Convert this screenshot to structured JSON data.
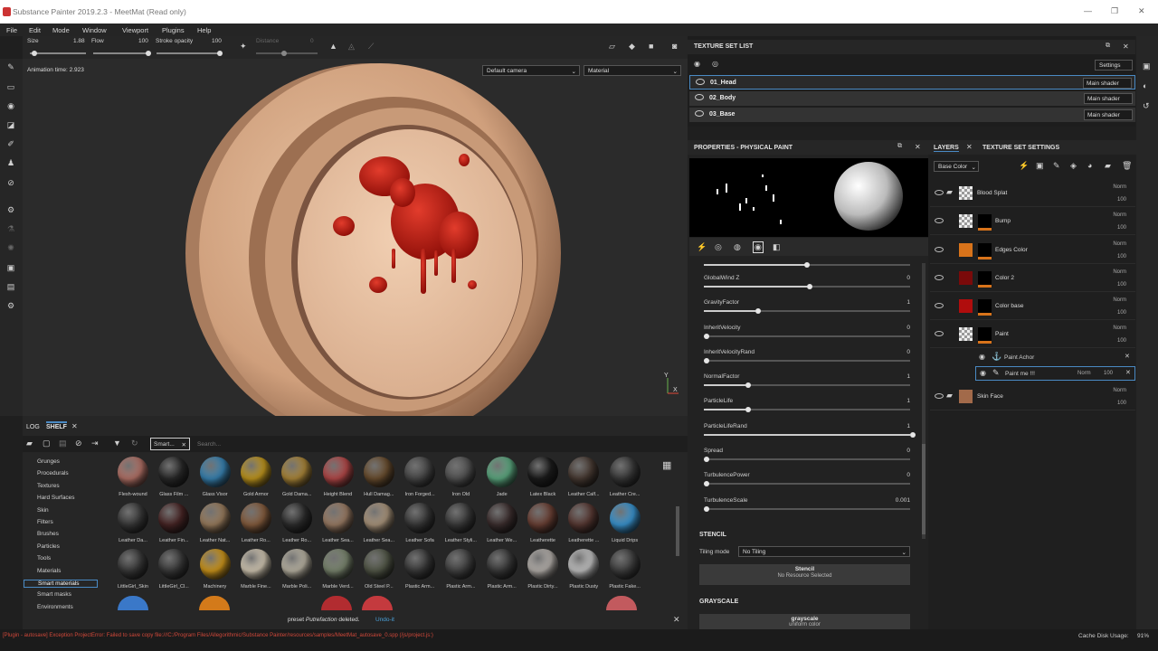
{
  "window": {
    "title": "Substance Painter 2019.2.3 - MeetMat (Read only)",
    "min": "—",
    "max": "❐",
    "close": "✕"
  },
  "menu": [
    "File",
    "Edit",
    "Mode",
    "Window",
    "Viewport",
    "Plugins",
    "Help"
  ],
  "toolbar": {
    "size_label": "Size",
    "size_value": "1.88",
    "flow_label": "Flow",
    "flow_value": "100",
    "stroke_label": "Stroke opacity",
    "stroke_value": "100",
    "distance_label": "Distance",
    "distance_value": "0"
  },
  "viewport": {
    "animation_time": "Animation time: 2.923",
    "camera": "Default camera",
    "mode": "Material",
    "axis_y": "Y",
    "axis_x": "X"
  },
  "texture_set_list": {
    "title": "TEXTURE SET LIST",
    "settings": "Settings",
    "sets": [
      {
        "name": "01_Head",
        "shader": "Main shader"
      },
      {
        "name": "02_Body",
        "shader": "Main shader"
      },
      {
        "name": "03_Base",
        "shader": "Main shader"
      }
    ]
  },
  "properties": {
    "title": "PROPERTIES - PHYSICAL PAINT",
    "rows": [
      {
        "label": "GlobalWind Z",
        "value": "0",
        "fill": 0.5
      },
      {
        "label": "GravityFactor",
        "value": "1",
        "fill": 0.25
      },
      {
        "label": "InheritVelocity",
        "value": "0",
        "fill": 0.0
      },
      {
        "label": "InheritVelocityRand",
        "value": "0",
        "fill": 0.0
      },
      {
        "label": "NormalFactor",
        "value": "1",
        "fill": 0.2
      },
      {
        "label": "ParticleLife",
        "value": "1",
        "fill": 0.2
      },
      {
        "label": "ParticleLifeRand",
        "value": "1",
        "fill": 1.0
      },
      {
        "label": "Spread",
        "value": "0",
        "fill": 0.0
      },
      {
        "label": "TurbulencePower",
        "value": "0",
        "fill": 0.0
      },
      {
        "label": "TurbulenceScale",
        "value": "0.001",
        "fill": 0.0
      }
    ],
    "stencil": "STENCIL",
    "tiling_label": "Tiling mode",
    "tiling_value": "No Tiling",
    "stencil_btn": "Stencil",
    "stencil_sub": "No Resource Selected",
    "grayscale": "GRAYSCALE",
    "grayscale_btn": "grayscale",
    "grayscale_sub": "uniform color"
  },
  "layers": {
    "tab_layers": "LAYERS",
    "tab_tss": "TEXTURE SET SETTINGS",
    "channel": "Base Color",
    "items": [
      {
        "name": "Blood Splat",
        "blend": "Norm",
        "opacity": "100",
        "thumb": "#cccccc"
      },
      {
        "name": "Bump",
        "blend": "Norm",
        "opacity": "100",
        "thumb": "#cccccc"
      },
      {
        "name": "Edges Color",
        "blend": "Norm",
        "opacity": "100",
        "thumb": "#d8731a"
      },
      {
        "name": "Color 2",
        "blend": "Norm",
        "opacity": "100",
        "thumb": "#7a0a0a"
      },
      {
        "name": "Color base",
        "blend": "Norm",
        "opacity": "100",
        "thumb": "#b00d0d"
      },
      {
        "name": "Paint",
        "blend": "Norm",
        "opacity": "100",
        "thumb": "#cccccc"
      }
    ],
    "sub_anchor": "Paint Achor",
    "sub_paint": "Paint me !!!",
    "sub_blend": "Norm",
    "sub_opacity": "100",
    "skin": {
      "name": "Skin Face",
      "blend": "Norm",
      "opacity": "100"
    }
  },
  "shelf": {
    "tab_log": "LOG",
    "tab_shelf": "SHELF",
    "filter": "Smart...",
    "search_placeholder": "Search...",
    "categories": [
      "Grunges",
      "Procedurals",
      "Textures",
      "Hard Surfaces",
      "Skin",
      "Filters",
      "Brushes",
      "Particles",
      "Tools",
      "Materials",
      "Smart materials",
      "Smart masks",
      "Environments"
    ],
    "selected": "Smart materials",
    "items": [
      [
        "Flesh-wound",
        "Glass Film ...",
        "Glass Visor",
        "Gold Armor",
        "Gold Dama...",
        "Height Blend",
        "Hull Damag...",
        "Iron Forged...",
        "Iron Old",
        "Jade",
        "Latex Black",
        "Leather Calf...",
        "Leather Cre..."
      ],
      [
        "Leather Da...",
        "Leather Fin...",
        "Leather Nat...",
        "Leather Ro...",
        "Leather Ro...",
        "Leather Sea...",
        "Leather Sea...",
        "Leather Sofa",
        "Leather Styli...",
        "Leather We...",
        "Leatherette",
        "Leatherette ...",
        "Liquid Drips"
      ],
      [
        "LittleGirl_Skin",
        "LittleGirl_Cl...",
        "Machinery",
        "Marble Fine...",
        "Marble Poli...",
        "Marble Verd...",
        "Old Steel P...",
        "Plastic Arm...",
        "Plastic Arm...",
        "Plastic Arm...",
        "Plastic Dirty...",
        "Plastic Dusty",
        "Plastic Fake..."
      ]
    ],
    "colors": [
      [
        "#b8756a",
        "#2b2b2b",
        "#3a87b8",
        "#c59a1e",
        "#b08a3a",
        "#b94a4a",
        "#6d5030",
        "#4a4a4a",
        "#555",
        "#5fae84",
        "#1d1d1d",
        "#4a3c34",
        "#3a3a3a"
      ],
      [
        "#3a3a3a",
        "#4a2626",
        "#9e8060",
        "#8a6040",
        "#2e2e2e",
        "#a08068",
        "#b09a80",
        "#3a3a3a",
        "#3c3c3c",
        "#3e3030",
        "#6e4236",
        "#5a3a34",
        "#3c9ad8"
      ],
      [
        "#3a3a3a",
        "#3a3a3a",
        "#d39a1c",
        "#d8cdb8",
        "#bfb9a8",
        "#7e8a72",
        "#555a4a",
        "#3a3a3a",
        "#444",
        "#3a3a3a",
        "#bab5b0",
        "#c8c8c8",
        "#404040"
      ]
    ]
  },
  "notification": {
    "prefix": "preset ",
    "italic": "Putrefaction",
    "suffix": " deleted.",
    "undo": "Undo-it"
  },
  "status": {
    "error": "[Plugin - autosave] Exception ProjectError: Failed to save copy file:///C:/Program Files/Allegorithmic/Substance Painter/resources/samples/MeetMat_autosave_0.spp (/js/project.js:)",
    "cache_label": "Cache Disk Usage:",
    "cache_value": "91%"
  }
}
